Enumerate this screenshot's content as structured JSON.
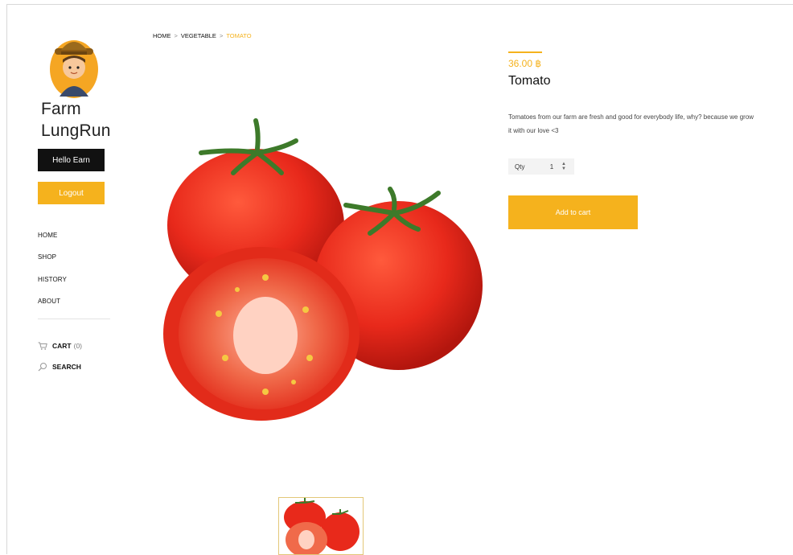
{
  "brand": {
    "line1": "Farm",
    "line2": "LungRun",
    "avatar_icon": "farmer-avatar-icon"
  },
  "user": {
    "greeting_button": "Hello Earn",
    "logout_button": "Logout"
  },
  "nav": {
    "items": [
      {
        "label": "HOME"
      },
      {
        "label": "SHOP"
      },
      {
        "label": "HISTORY"
      },
      {
        "label": "ABOUT"
      }
    ]
  },
  "utility": {
    "cart_label": "CART",
    "cart_count": "(0)",
    "cart_icon": "cart-icon",
    "search_label": "SEARCH",
    "search_icon": "search-icon"
  },
  "breadcrumb": {
    "items": [
      "HOME",
      "VEGETABLE",
      "TOMATO"
    ],
    "separator": ">"
  },
  "product": {
    "price": "36.00 ฿",
    "name": "Tomato",
    "description": "Tomatoes from our farm are fresh and good for everybody life, why? because we grow it with our love <3",
    "qty_label": "Qty",
    "qty_value": "1",
    "add_to_cart": "Add to cart"
  },
  "colors": {
    "accent": "#f5b21d",
    "dark_button": "#111111",
    "tomato_red": "#e8291b"
  }
}
